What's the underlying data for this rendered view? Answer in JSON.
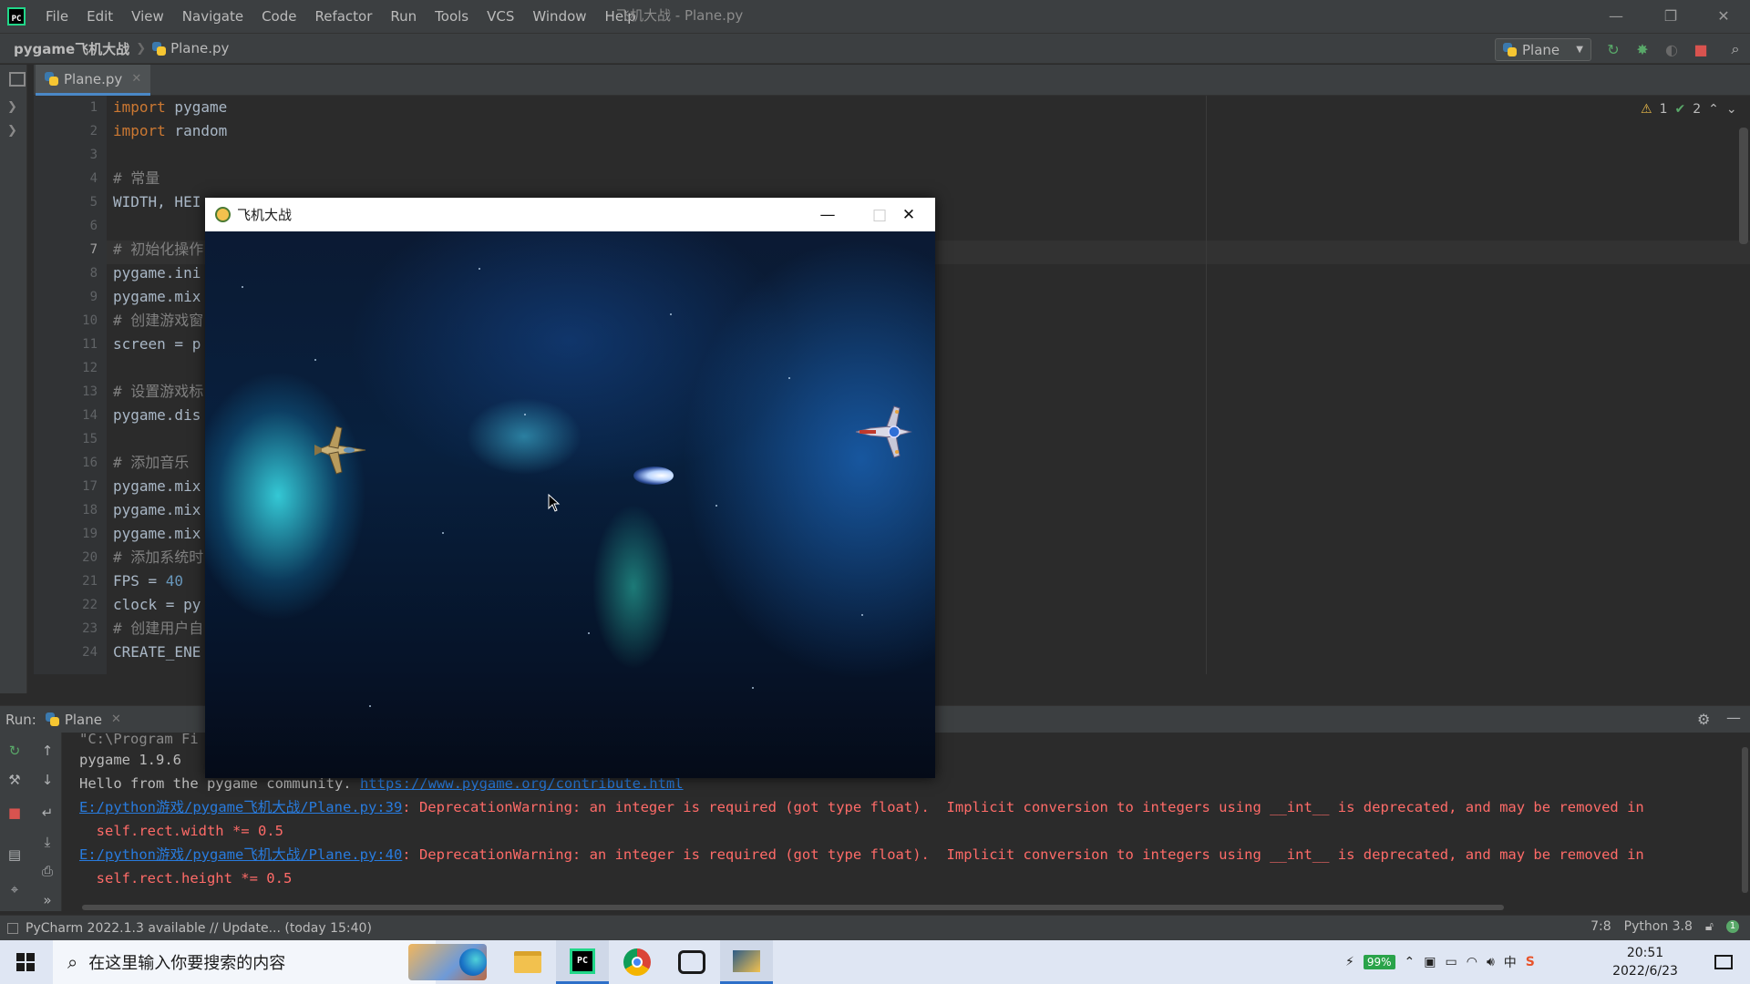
{
  "menubar": {
    "items": [
      "File",
      "Edit",
      "View",
      "Navigate",
      "Code",
      "Refactor",
      "Run",
      "Tools",
      "VCS",
      "Window",
      "Help"
    ],
    "window_title": "飞机大战 - Plane.py"
  },
  "navbar": {
    "project": "pygame飞机大战",
    "file": "Plane.py",
    "run_config": "Plane"
  },
  "tabs": [
    {
      "label": "Plane.py"
    }
  ],
  "inspections": {
    "warnings": "1",
    "weak_warnings": "2"
  },
  "editor": {
    "line_numbers": [
      "1",
      "2",
      "3",
      "4",
      "5",
      "6",
      "7",
      "8",
      "9",
      "10",
      "11",
      "12",
      "13",
      "14",
      "15",
      "16",
      "17",
      "18",
      "19",
      "20",
      "21",
      "22",
      "23",
      "24"
    ],
    "lines": [
      {
        "kw": "import",
        "rest": " pygame"
      },
      {
        "kw": "import",
        "rest": " random"
      },
      {
        "text": ""
      },
      {
        "comment": "# 常量"
      },
      {
        "text": "WIDTH, HEI"
      },
      {
        "text": ""
      },
      {
        "comment": "# 初始化操作"
      },
      {
        "text": "pygame.ini"
      },
      {
        "text": "pygame.mix"
      },
      {
        "comment": "# 创建游戏窗"
      },
      {
        "text": "screen = p"
      },
      {
        "text": ""
      },
      {
        "comment": "# 设置游戏标"
      },
      {
        "text": "pygame.dis"
      },
      {
        "text": ""
      },
      {
        "comment": "# 添加音乐"
      },
      {
        "text": "pygame.mix"
      },
      {
        "text": "pygame.mix"
      },
      {
        "text": "pygame.mix"
      },
      {
        "comment": "# 添加系统时"
      },
      {
        "text": "FPS = ",
        "num": "40"
      },
      {
        "text": "clock = py"
      },
      {
        "comment": "# 创建用户自"
      },
      {
        "text": "CREATE_ENE"
      }
    ]
  },
  "game_window": {
    "title": "飞机大战"
  },
  "run_panel": {
    "label": "Run:",
    "tab": "Plane",
    "console": {
      "line0": "\"C:\\Program Fi",
      "line1": "pygame 1.9.6",
      "line2_text": "Hello from the pygame community. ",
      "line2_link": "https://www.pygame.org/contribute.html",
      "line3_link": "E:/python游戏/pygame飞机大战/Plane.py:39",
      "line3_msg": ": DeprecationWarning: an integer is required (got type float).  Implicit conversion to integers using __int__ is deprecated, and may be removed in",
      "line4": "  self.rect.width *= 0.5",
      "line5_link": "E:/python游戏/pygame飞机大战/Plane.py:40",
      "line5_msg": ": DeprecationWarning: an integer is required (got type float).  Implicit conversion to integers using __int__ is deprecated, and may be removed in",
      "line6": "  self.rect.height *= 0.5"
    }
  },
  "statusbar": {
    "message": "PyCharm 2022.1.3 available // Update... (today 15:40)",
    "position": "7:8",
    "interpreter": "Python 3.8"
  },
  "taskbar": {
    "search_placeholder": "在这里输入你要搜索的内容",
    "battery": "99%",
    "ime": "中",
    "time": "20:51",
    "date": "2022/6/23"
  },
  "colors": {
    "editor_bg": "#2b2b2b",
    "keyword": "#cc7832",
    "comment": "#808080",
    "number": "#6897bb",
    "error_text": "#ff6b68",
    "link": "#287bde",
    "accent": "#4a88c7"
  }
}
